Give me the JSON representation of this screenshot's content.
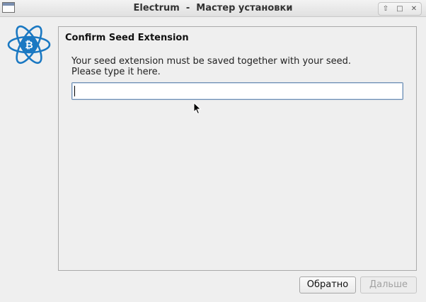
{
  "window": {
    "title": "Electrum  -  Мастер установки",
    "controls": {
      "up_glyph": "⇧",
      "max_glyph": "□",
      "close_glyph": "✕"
    }
  },
  "page": {
    "heading": "Confirm Seed Extension",
    "description_line1": "Your seed extension must be saved together with your seed.",
    "description_line2": "Please type it here.",
    "input_value": ""
  },
  "buttons": {
    "back_label": "Обратно",
    "next_label": "Дальше",
    "next_enabled": false
  },
  "colors": {
    "logo": "#1a78c2",
    "input_border": "#6f8fb3"
  },
  "icons": {
    "app_logo": "electrum-logo-icon",
    "window_icon": "window-icon",
    "cursor": "mouse-pointer-icon"
  }
}
